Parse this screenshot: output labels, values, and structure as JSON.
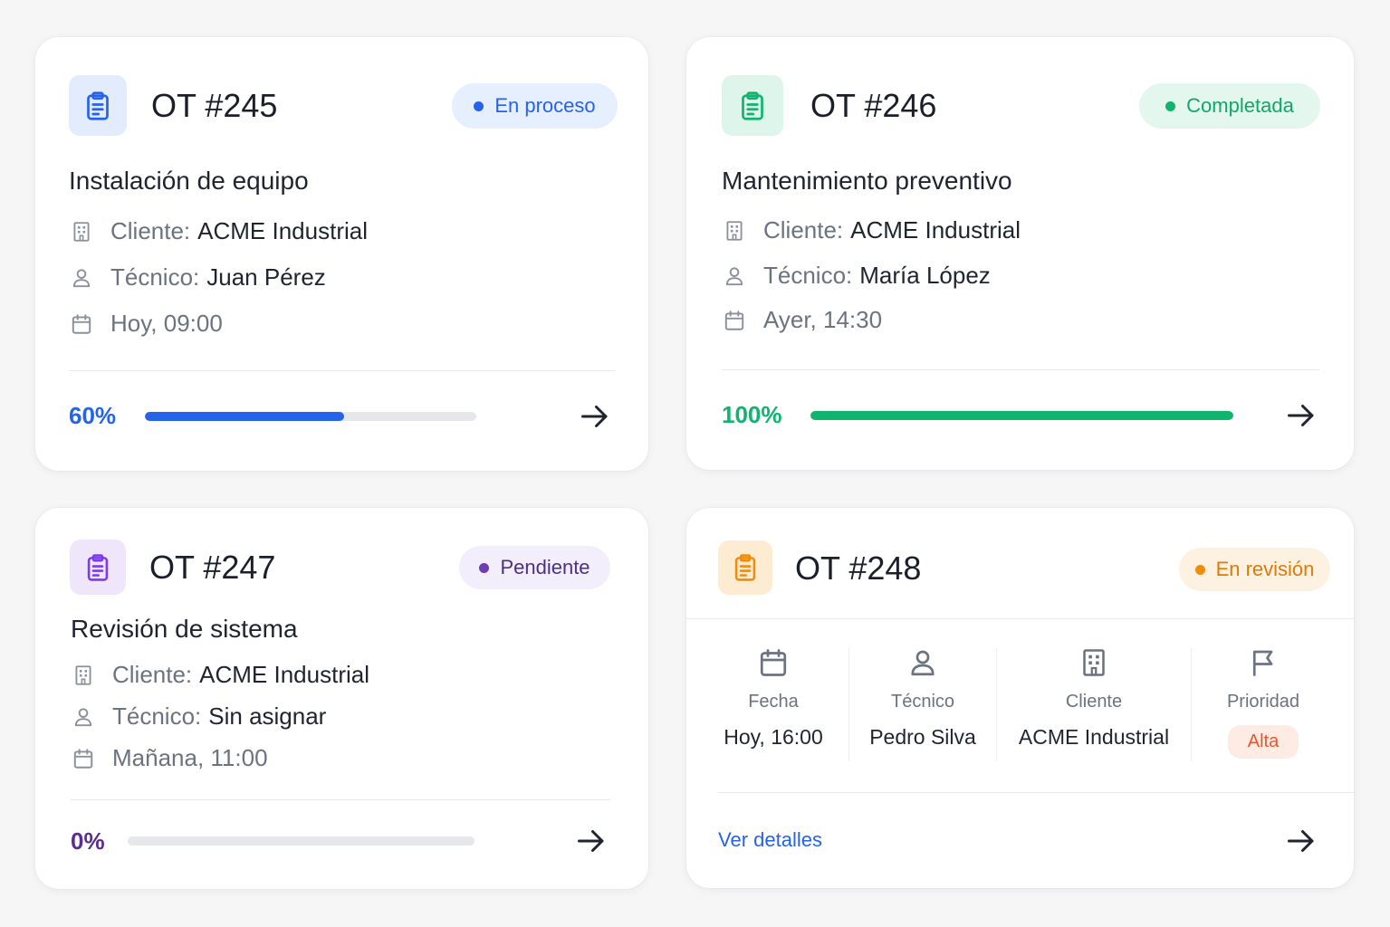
{
  "orders": [
    {
      "title": "OT #245",
      "status": "En proceso",
      "subtitle": "Instalación de equipo",
      "client_label": "Cliente:",
      "client": "ACME Industrial",
      "tech_label": "Técnico:",
      "tech": "Juan Pérez",
      "date": "Hoy, 09:00",
      "progress_text": "60%",
      "progress": 0.6,
      "accent": "#2563eb",
      "icon": "clipboard-icon"
    },
    {
      "title": "OT #246",
      "status": "Completada",
      "subtitle": "Mantenimiento preventivo",
      "client_label": "Cliente:",
      "client": "ACME Industrial",
      "tech_label": "Técnico:",
      "tech": "María López",
      "date": "Ayer, 14:30",
      "progress_text": "100%",
      "progress": 1.0,
      "accent": "#10b46e",
      "icon": "clipboard-icon"
    },
    {
      "title": "OT #247",
      "status": "Pendiente",
      "subtitle": "Revisión de sistema",
      "client_label": "Cliente:",
      "client": "ACME Industrial",
      "tech_label": "Técnico:",
      "tech": "Sin asignar",
      "date": "Mañana, 11:00",
      "progress_text": "0%",
      "progress": 0.0,
      "accent": "#6d3fb3",
      "icon": "clipboard-icon"
    },
    {
      "title": "OT #248",
      "status": "En revisión",
      "accent": "#f08c0a",
      "icon": "clipboard-icon",
      "details": [
        {
          "label": "Fecha",
          "value": "Hoy, 16:00",
          "icon": "calendar-icon"
        },
        {
          "label": "Técnico",
          "value": "Pedro Silva",
          "icon": "user-icon"
        },
        {
          "label": "Cliente",
          "value": "ACME Industrial",
          "icon": "building-icon"
        },
        {
          "label": "Prioridad",
          "value": "Alta",
          "icon": "flag-icon"
        }
      ],
      "link": "Ver detalles"
    }
  ]
}
